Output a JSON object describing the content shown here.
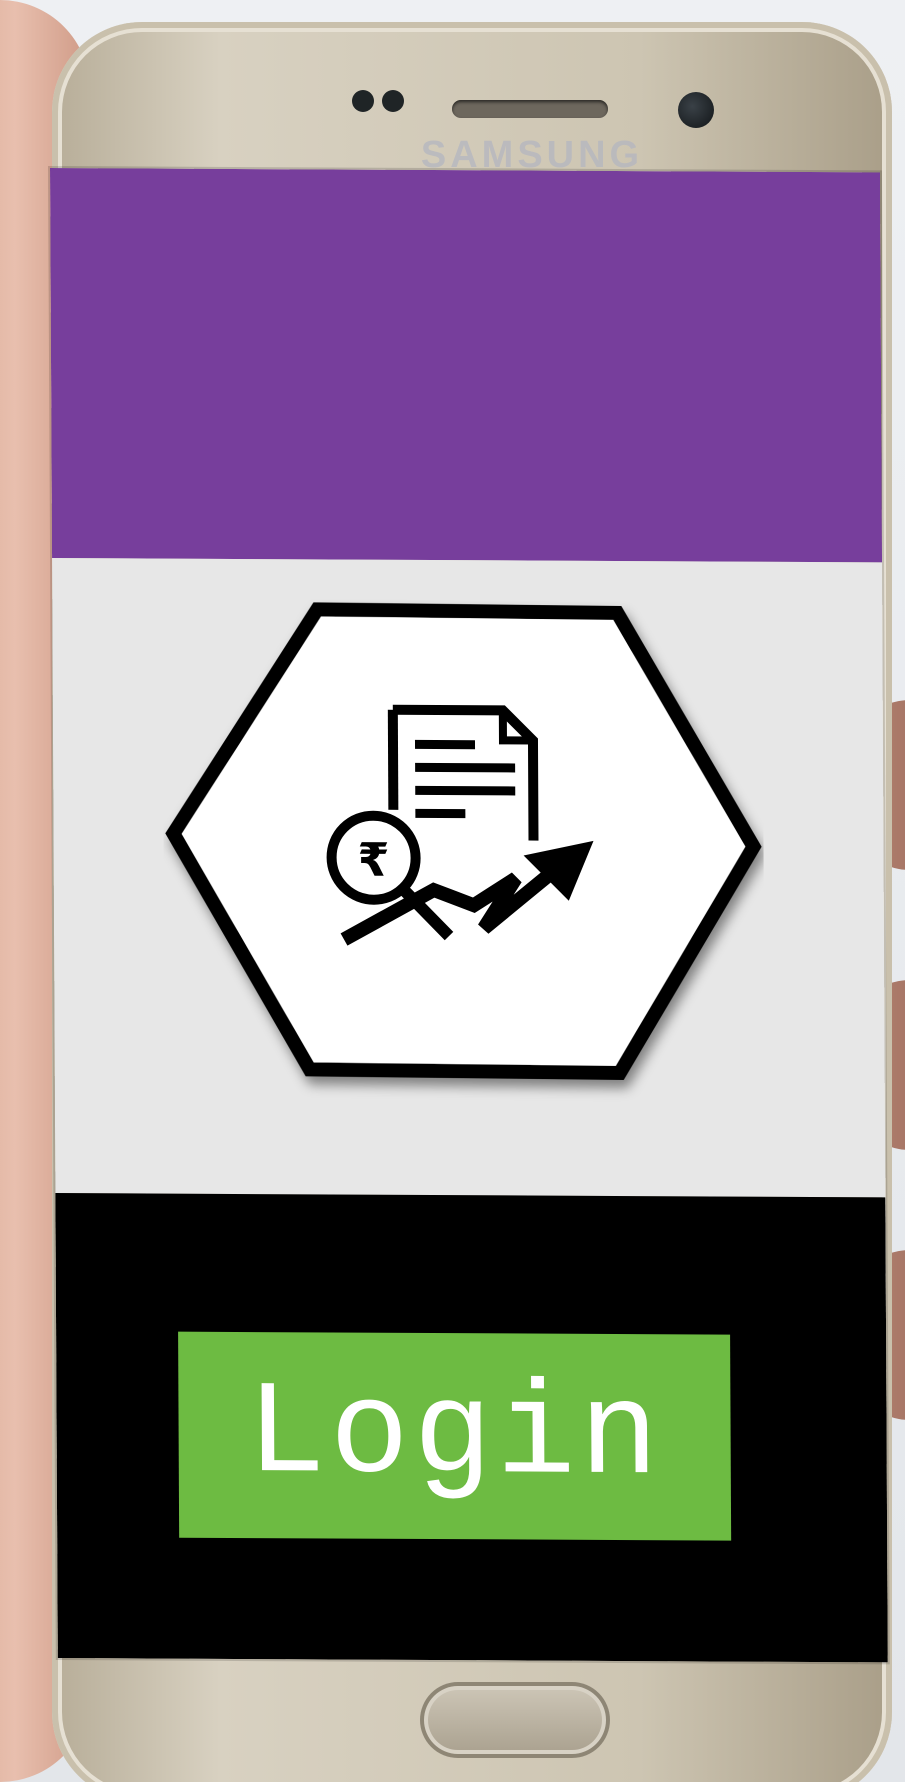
{
  "device": {
    "brand_text": "SAMSUNG"
  },
  "app": {
    "header_color": "#773e9c",
    "body_color": "#e7e7e7",
    "footer_color": "#000000",
    "logo": {
      "icon": "finance-report-rupee-growth-icon",
      "symbol": "₹"
    },
    "login_button": {
      "label": "Login",
      "color": "#6dbb42"
    }
  }
}
